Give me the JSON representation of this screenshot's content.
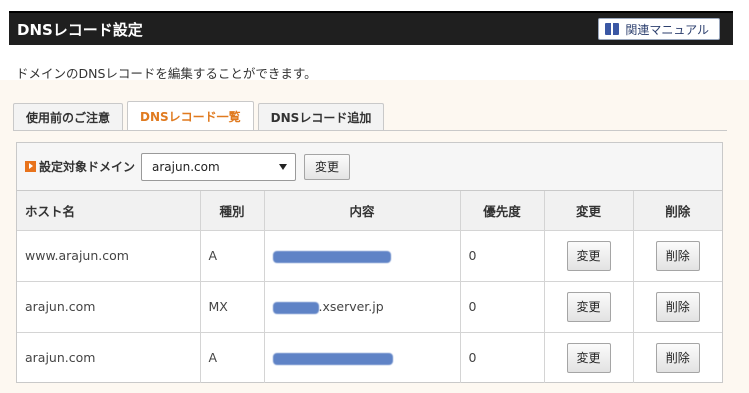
{
  "header": {
    "title": "DNSレコード設定",
    "manual_label": "関連マニュアル"
  },
  "description": "ドメインのDNSレコードを編集することができます。",
  "tabs": [
    {
      "label": "使用前のご注意",
      "active": false
    },
    {
      "label": "DNSレコード一覧",
      "active": true
    },
    {
      "label": "DNSレコード追加",
      "active": false
    }
  ],
  "filter": {
    "label": "設定対象ドメイン",
    "selected_domain": "arajun.com",
    "change_label": "変更"
  },
  "table": {
    "headers": [
      "ホスト名",
      "種別",
      "内容",
      "優先度",
      "変更",
      "削除"
    ],
    "rows": [
      {
        "host": "www.arajun.com",
        "type": "A",
        "content": "",
        "priority": "0",
        "edit": "変更",
        "delete": "削除"
      },
      {
        "host": "arajun.com",
        "type": "MX",
        "content": ".xserver.jp",
        "priority": "0",
        "edit": "変更",
        "delete": "削除"
      },
      {
        "host": "arajun.com",
        "type": "A",
        "content": "",
        "priority": "0",
        "edit": "変更",
        "delete": "削除"
      }
    ]
  },
  "colors": {
    "header_bg": "#1f1f1f",
    "active_tab": "#e07a1f",
    "accent_bullet": "#e8731c",
    "content_bg": "#fdf8f1"
  }
}
